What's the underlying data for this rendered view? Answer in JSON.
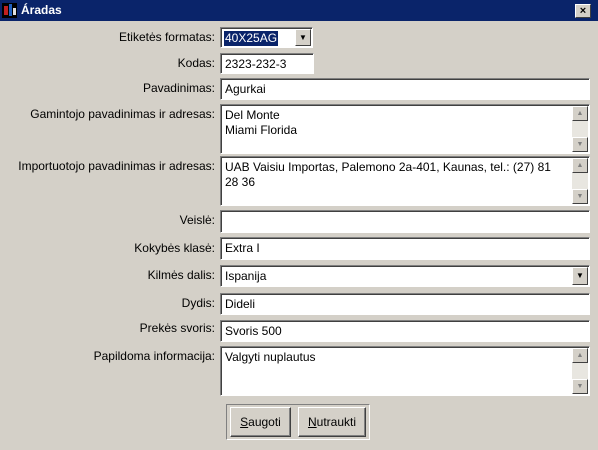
{
  "window": {
    "title": "Áradas",
    "close_label": "×"
  },
  "form": {
    "label_format": "Etiketės formatas:",
    "format_value": "40X25AG",
    "label_code": "Kodas:",
    "code_value": "2323-232-3",
    "label_name": "Pavadinimas:",
    "name_value": "Agurkai",
    "label_manufacturer": "Gamintojo pavadinimas ir adresas:",
    "manufacturer_value": "Del Monte\nMiami Florida",
    "label_importer": "Importuotojo pavadinimas ir adresas:",
    "importer_value": "UAB Vaisiu Importas, Palemono 2a-401, Kaunas, tel.: (27) 81 28 36",
    "label_variety": "Veislė:",
    "variety_value": "",
    "label_quality": "Kokybės klasė:",
    "quality_value": "Extra I",
    "label_origin": "Kilmės dalis:",
    "origin_value": "Ispanija",
    "label_size": "Dydis:",
    "size_value": "Dideli",
    "label_weight": "Prekės svoris:",
    "weight_value": "Svoris 500",
    "label_extra": "Papildoma informacija:",
    "extra_value": "Valgyti nuplautus"
  },
  "buttons": {
    "save_hotkey": "S",
    "save_rest": "augoti",
    "cancel_hotkey": "N",
    "cancel_rest": "utraukti"
  },
  "icons": {
    "scroll_up": "▲",
    "scroll_down": "▼",
    "dropdown": "▼"
  }
}
